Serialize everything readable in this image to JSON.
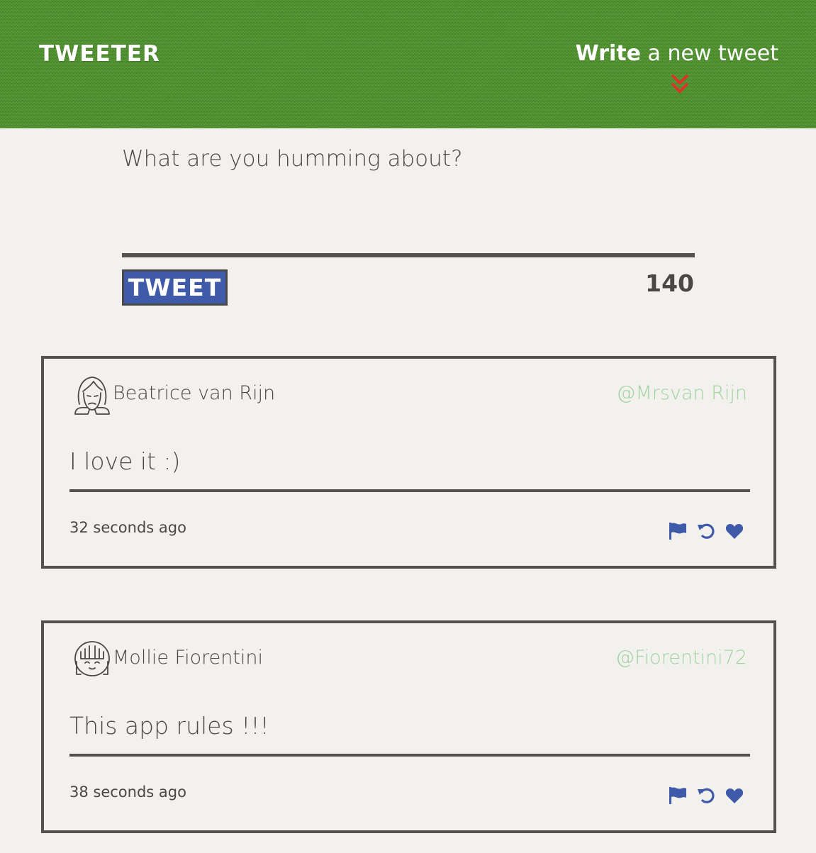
{
  "header": {
    "logo": "TWEETER",
    "compose_toggle_bold": "Write",
    "compose_toggle_rest": " a new tweet"
  },
  "composer": {
    "placeholder": "What are you humming about?",
    "button_label": "TWEET",
    "char_counter": "140"
  },
  "tweets": [
    {
      "author": "Beatrice van Rijn",
      "handle": "@Mrsvan Rijn",
      "text": "I love it :)",
      "time": "32 seconds ago"
    },
    {
      "author": "Mollie Fiorentini",
      "handle": "@Fiorentini72",
      "text": "This app rules !!!",
      "time": "38 seconds ago"
    }
  ],
  "icons": {
    "toggle": "double-chevron-down-icon",
    "flag": "flag-icon",
    "retweet": "retweet-icon",
    "like": "heart-icon"
  },
  "colors": {
    "header_green": "#4d8f2e",
    "chevron_red": "#d9352b",
    "button_blue": "#3f5aa8",
    "handle_green": "#9fd3a1",
    "action_blue": "#3f5aa8",
    "background": "#f3f1ed"
  }
}
